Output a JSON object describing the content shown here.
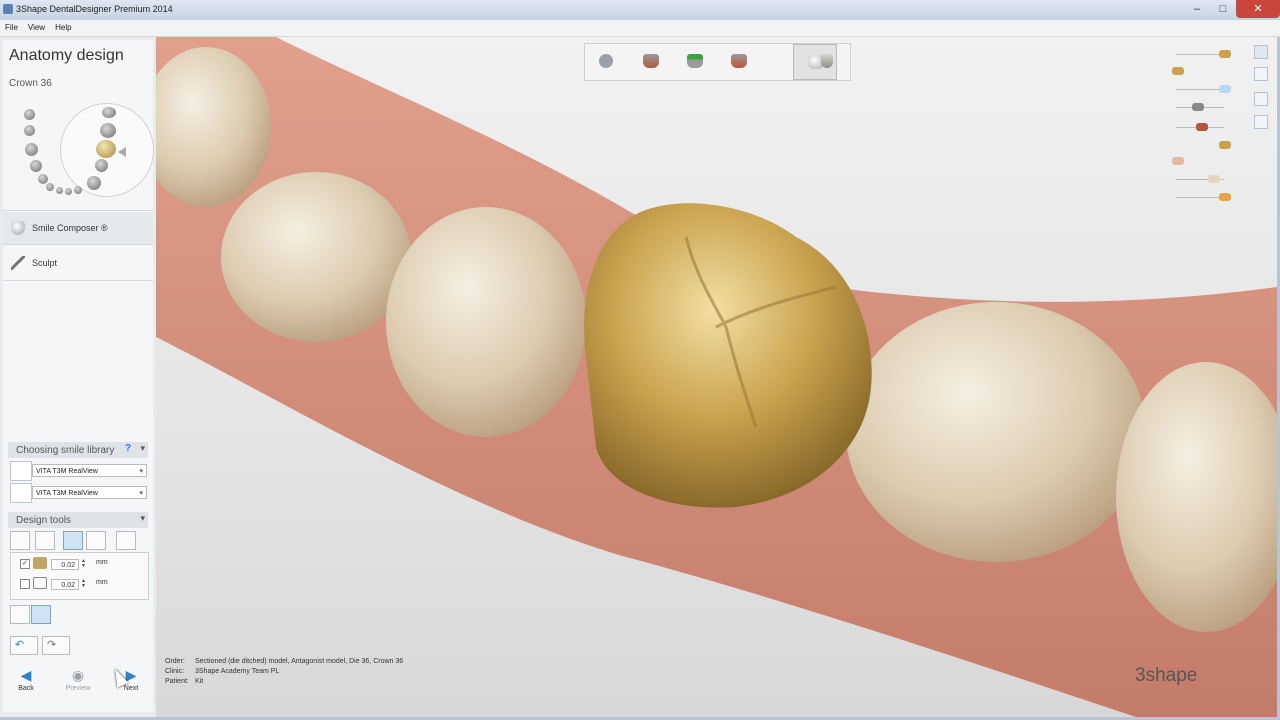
{
  "window": {
    "title": "3Shape DentalDesigner Premium 2014",
    "minimize": "–",
    "maximize": "□",
    "close": "✕"
  },
  "menu": [
    "File",
    "View",
    "Help"
  ],
  "panel": {
    "title": "Anatomy design",
    "subtitle": "Crown 36",
    "tools": [
      {
        "label": "Smile Composer ®",
        "icon": "tooth-icon"
      },
      {
        "label": "Sculpt",
        "icon": "sculpt-icon"
      }
    ],
    "library": {
      "header": "Choosing smile library",
      "help": "?",
      "options": [
        "VITA T3M RealView",
        "VITA T3M RealView"
      ]
    },
    "design_tools": {
      "header": "Design tools",
      "params": [
        {
          "checked": true,
          "value": "0.02",
          "unit": "mm"
        },
        {
          "checked": false,
          "value": "0.02",
          "unit": "mm"
        }
      ]
    },
    "nav": {
      "back": "Back",
      "preview": "Preview",
      "next": "Next"
    }
  },
  "viewport": {
    "info": [
      {
        "key": "Order:",
        "value": "Sectioned (die ditched) model, Antagonist model, Die 36, Crown 36"
      },
      {
        "key": "Clinic:",
        "value": "3Shape Academy Team PL"
      },
      {
        "key": "Patient:",
        "value": "Kit"
      }
    ],
    "logo": "3shape",
    "toolbar": [
      "scissors-model-icon",
      "die-icon",
      "insertion-icon",
      "cement-gap-icon",
      "anatomy-icon",
      "crown-icon"
    ],
    "colors": {
      "crown": "#c9a24e",
      "gum": "#d69078",
      "tooth": "#e9dcc6",
      "accent": "#2f82c8"
    }
  }
}
